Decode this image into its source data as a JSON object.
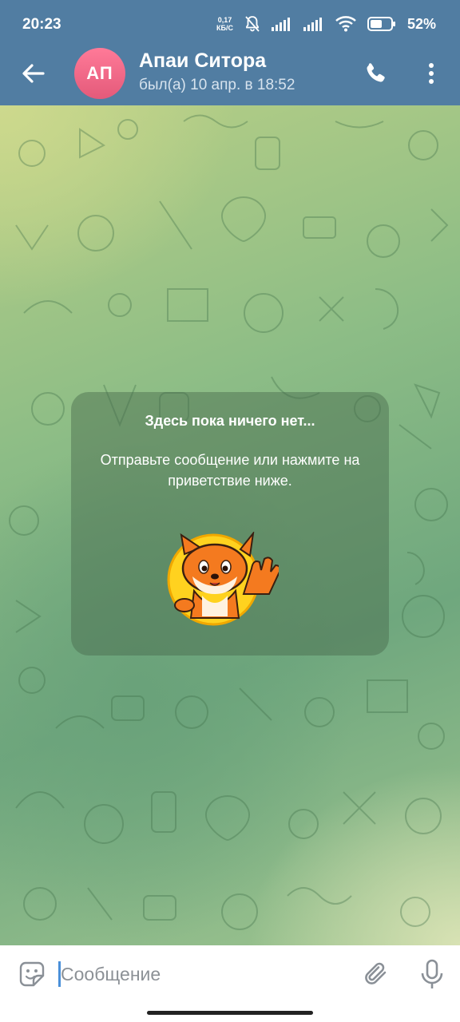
{
  "status_bar": {
    "time": "20:23",
    "speed_value": "0,17",
    "speed_unit": "КБ/С",
    "battery_percent": "52%"
  },
  "header": {
    "avatar_initials": "АП",
    "avatar_color": "#e86584",
    "contact_name": "Апаи Ситора",
    "last_seen": "был(а) 10 апр. в 18:52",
    "accent_color": "#517da2"
  },
  "chat": {
    "empty_title": "Здесь пока ничего нет...",
    "empty_description": "Отправьте сообщение или нажмите на приветствие ниже.",
    "sticker_icon": "waving-fox-sticker"
  },
  "composer": {
    "placeholder": "Сообщение",
    "value": ""
  },
  "icons": {
    "back": "arrow-left-icon",
    "call": "phone-icon",
    "more": "more-vertical-icon",
    "emoji": "sticker-emoji-icon",
    "attach": "paperclip-icon",
    "mic": "microphone-icon"
  }
}
